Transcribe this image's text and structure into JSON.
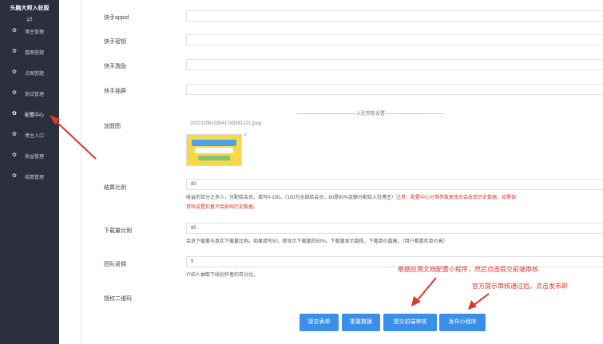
{
  "sidebar": {
    "brand": "头脑大师入驻版",
    "toggle_icon": "⇄",
    "items": [
      {
        "label": "博主管理",
        "icon": "gear-icon"
      },
      {
        "label": "看图答题",
        "icon": "gear-icon"
      },
      {
        "label": "点图答题",
        "icon": "gear-icon"
      },
      {
        "label": "测试管理",
        "icon": "gear-icon"
      },
      {
        "label": "配置中心",
        "icon": "gear-icon",
        "active": true
      },
      {
        "label": "博主入口",
        "icon": "gear-icon"
      },
      {
        "label": "收益管理",
        "icon": "gear-icon"
      },
      {
        "label": "结算管理",
        "icon": "gear-icon"
      }
    ]
  },
  "form": {
    "kuaishou_appid_label": "快手appid",
    "kuaishou_secret_label": "快手密钥",
    "kuaishou_incentive_label": "快手激励",
    "kuaishou_interstitial_label": "快手插屏",
    "section_title": "-------------------------------------入驻参数设置-------------------------------------",
    "banner_label": "加盟图",
    "banner_filename": "20221105103941?d3381221.jpeg",
    "banner_close": "×",
    "settle_label": "结算比例",
    "settle_value": "80",
    "settle_hint": "收益的百分之多少，分配给会员。填写0-100。（100为全部给会员，80是80%金额分配给入驻博主）",
    "settle_warn1": "注意：配置中心分佣参数更改后会改变历史数据。如需保",
    "settle_warn2": "资料设置扣量不会影响历史数据。",
    "download_label": "下载量比例",
    "download_value": "80",
    "download_hint": "会员下载量与真实下载量比例。如果填写50，即显示下载量的50%。下载量显示越低，下载单价越高。（用户都喜欢单价高）",
    "team_label": "团队返佣",
    "team_value": "5",
    "team_hint": "介绍人抽取下线创作者的百分比。",
    "qrcode_label": "授权二维码"
  },
  "buttons": {
    "submit": "提交表单",
    "reset": "重置数据",
    "review": "提交前端审核",
    "publish": "发布小程序"
  },
  "annotations": {
    "note1": "根据应用文档配置小程序，然后点击提交前端审核",
    "note2": "官方提示审核通过后，点击发布即"
  },
  "colors": {
    "sidebar_bg": "#2c2f3d",
    "button_blue": "#3b8fe8",
    "annotation_red": "#e0352b"
  }
}
